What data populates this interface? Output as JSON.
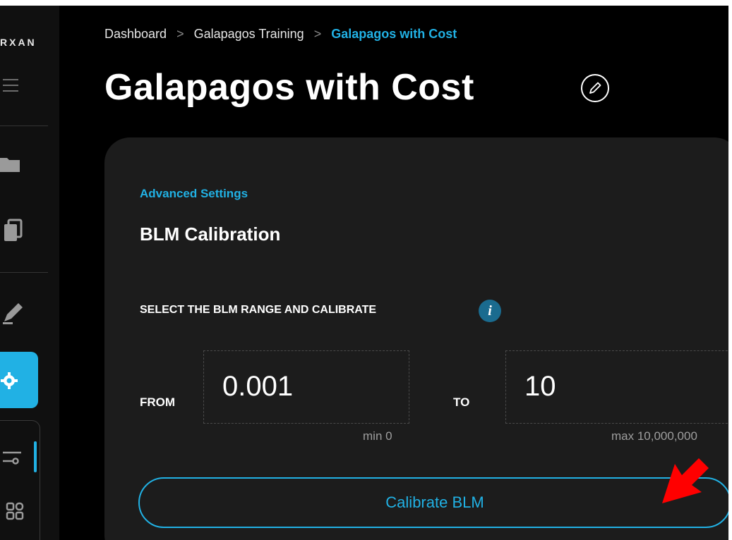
{
  "sidebar": {
    "brand": "RXAN",
    "icons": [
      "menu-icon",
      "folder-icon",
      "copy-icon",
      "edit-icon",
      "gear-icon",
      "sliders-icon",
      "grid-icon"
    ]
  },
  "breadcrumb": {
    "items": [
      "Dashboard",
      "Galapagos Training",
      "Galapagos with Cost"
    ],
    "separator": ">"
  },
  "page": {
    "title": "Galapagos with Cost"
  },
  "panel": {
    "eyebrow": "Advanced Settings",
    "title": "BLM Calibration",
    "range_label": "SELECT THE BLM RANGE AND CALIBRATE",
    "from_label": "FROM",
    "to_label": "TO",
    "from_value": "0.001",
    "to_value": "10",
    "min_hint": "min 0",
    "max_hint": "max 10,000,000",
    "button_label": "Calibrate BLM"
  },
  "colors": {
    "accent": "#21b1e4",
    "background": "#000000",
    "panel": "#1c1c1c",
    "annotation_arrow": "#ff0000"
  }
}
